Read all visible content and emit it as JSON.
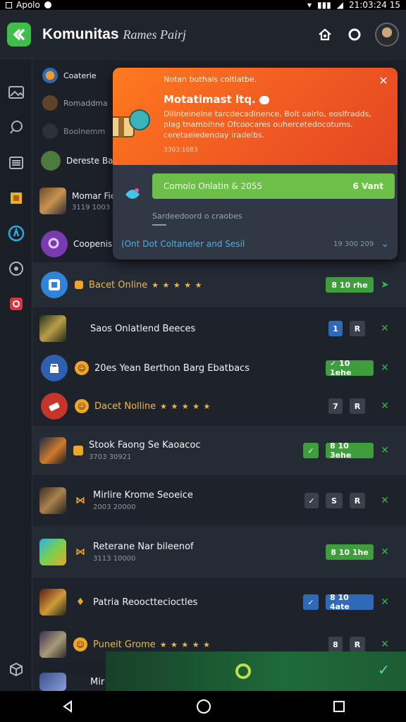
{
  "status_bar": {
    "carrier": "Apolo",
    "time": "21:03:24 15"
  },
  "header": {
    "title": "Komunitas",
    "subtitle": "Rames Pairj"
  },
  "colors": {
    "accent_green": "#3fbf4a",
    "popup_orange": "#f05a23",
    "action_green": "#6cc04a",
    "link_blue": "#45b3f0"
  },
  "top_items": [
    {
      "label": "Coaterie"
    },
    {
      "label": "Romaddma"
    },
    {
      "label": "Boolnemm"
    },
    {
      "label": "Dereste Bac"
    },
    {
      "label": "Momar Fie",
      "sub": "3119 1003"
    },
    {
      "label": "Coopenis"
    }
  ],
  "popup": {
    "small": "Notan buthais coltiatbe.",
    "title": "Motatimast ltq.",
    "description": "Dilinteinelne tarcdecadinence, Bolt oalrlo, eoslfradds, plag tnambihne Ofcoocares ouhercetedocotums. ceretaeledenday iradelbs.",
    "meta": "3303:1083",
    "action_left": "Comolo Onlatin & 2055",
    "action_right": "6 Vant",
    "secondary": "Sardeedoord o craobes",
    "footer_link": "(Ont Dot Coltaneler and Sesil",
    "footer_value": "19 300 209"
  },
  "rows": [
    {
      "title": "Bacet Online",
      "stars": "★ ★ ★ ★ ★",
      "badge": "8 10 rhe",
      "badge_color": "green",
      "action": "➤"
    },
    {
      "title": "Saos Onlatlend Beeces",
      "badge_a": "1",
      "badge_b": "R",
      "action": "✕"
    },
    {
      "title": "20es Yean Berthon Barg Ebatbacs",
      "badge": "✓ 10 1ehe",
      "badge_color": "green",
      "action": "✕"
    },
    {
      "title": "Dacet Nolline",
      "stars": "★ ★ ★ ★ ★",
      "badge_a": "7",
      "badge_b": "R",
      "action": "✕"
    },
    {
      "title": "Stook Faong Se Kaoacoc",
      "sub": "3703 30921",
      "badge_a": "✓",
      "badge": "8 10 3ehe",
      "badge_color": "green",
      "action": "✕"
    },
    {
      "title": "Mirlire Krome Seoeice",
      "sub": "2003 20000",
      "badge_a": "✓",
      "badge_b": "S",
      "badge_c": "R",
      "action": "✕"
    },
    {
      "title": "Reterane Nar bileenof",
      "sub": "3113 10000",
      "badge": "8 10 1he",
      "badge_color": "green",
      "action": "✕"
    },
    {
      "title": "Patria Reoocttecioctles",
      "badge_a": "✓",
      "badge": "8 10 4ate",
      "badge_color": "blue",
      "action": "✕"
    },
    {
      "title": "Puneit Grome",
      "stars": "★ ★ ★ ★ ★",
      "badge_a": "8",
      "badge_b": "R",
      "action": "✕"
    },
    {
      "title": "Mir"
    }
  ]
}
